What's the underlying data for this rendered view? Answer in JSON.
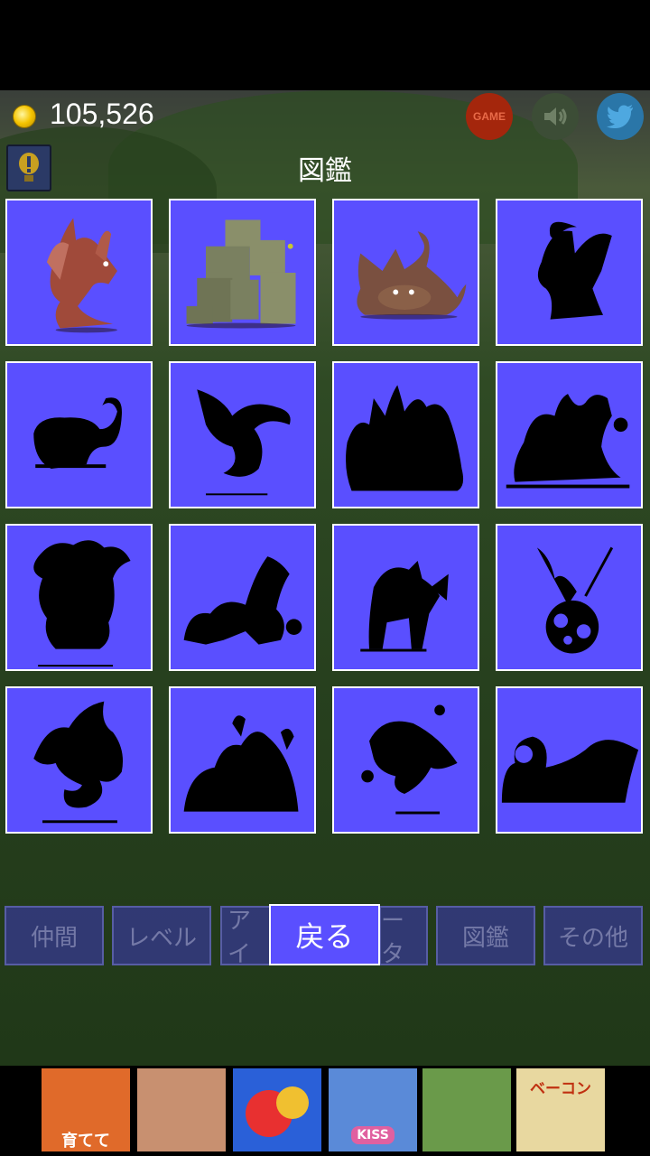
{
  "header": {
    "coins": "105,526",
    "game_label": "GAME",
    "title": "図鑑"
  },
  "bestiary": {
    "monsters": [
      {
        "state": "revealed",
        "icon": "red-dragon-icon",
        "color": "#a04a3a"
      },
      {
        "state": "revealed",
        "icon": "stone-golem-icon",
        "color": "#7a8060"
      },
      {
        "state": "revealed",
        "icon": "brown-dragon-icon",
        "color": "#7a5040"
      },
      {
        "state": "silhouette",
        "icon": "winged-demon-silhouette-icon"
      },
      {
        "state": "silhouette",
        "icon": "serpent-silhouette-icon"
      },
      {
        "state": "silhouette",
        "icon": "phoenix-silhouette-icon"
      },
      {
        "state": "silhouette",
        "icon": "hydra-silhouette-icon"
      },
      {
        "state": "silhouette",
        "icon": "chaos-beast-silhouette-icon"
      },
      {
        "state": "silhouette",
        "icon": "tree-monster-silhouette-icon"
      },
      {
        "state": "silhouette",
        "icon": "eastern-dragon-silhouette-icon"
      },
      {
        "state": "silhouette",
        "icon": "centaur-knight-silhouette-icon"
      },
      {
        "state": "silhouette",
        "icon": "knight-on-orb-silhouette-icon"
      },
      {
        "state": "silhouette",
        "icon": "wyvern-silhouette-icon"
      },
      {
        "state": "silhouette",
        "icon": "slime-mound-silhouette-icon"
      },
      {
        "state": "silhouette",
        "icon": "dragon-head-silhouette-icon"
      },
      {
        "state": "silhouette",
        "icon": "sea-serpent-silhouette-icon"
      }
    ]
  },
  "menu": {
    "items": [
      "仲間",
      "レベル",
      "アイ",
      "ータ",
      "図鑑",
      "その他"
    ],
    "back_label": "戻る"
  },
  "ads": [
    {
      "icon": "clash-ad-icon",
      "text": "育てて",
      "color": "#e06a2a"
    },
    {
      "icon": "romance-ad-icon",
      "text": "",
      "color": "#c89070"
    },
    {
      "icon": "candy-ad-icon",
      "text": "",
      "color": "#d83a3a"
    },
    {
      "icon": "anime-girl-ad-icon",
      "text": "KISS",
      "color": "#5a8ad8"
    },
    {
      "icon": "adventure-ad-icon",
      "text": "",
      "color": "#6a9a4a"
    },
    {
      "icon": "bacon-ad-icon",
      "text": "ベーコン",
      "color": "#e8d8a0"
    }
  ],
  "colors": {
    "card_bg": "#5a4fff",
    "card_border": "#ffffff"
  }
}
